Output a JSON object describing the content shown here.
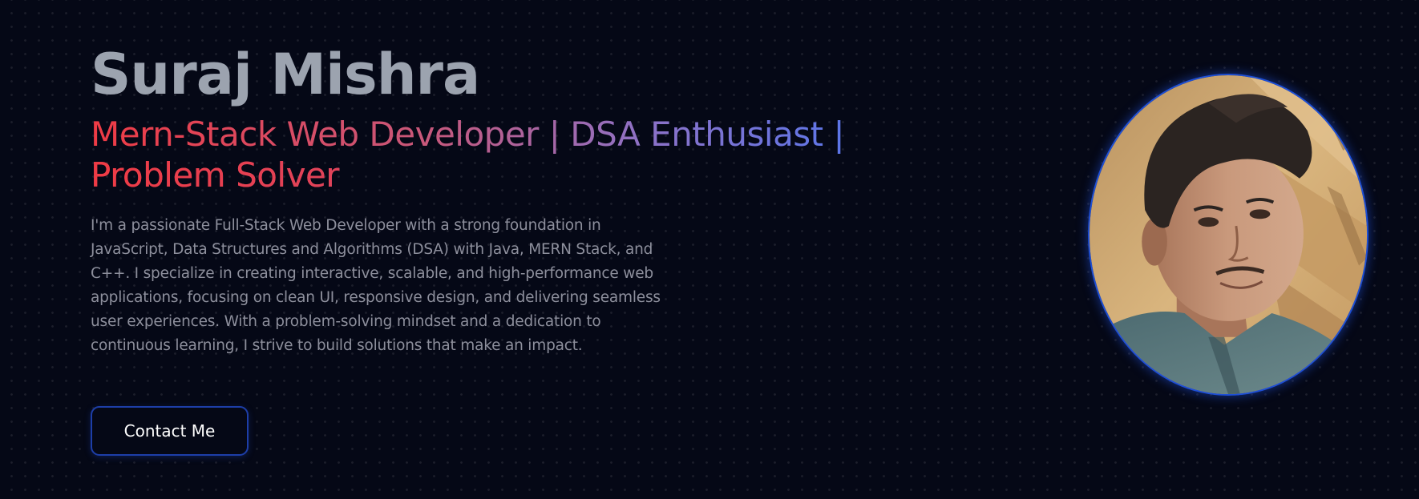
{
  "hero": {
    "name": "Suraj Mishra",
    "role_line1": "Mern-Stack Web Developer | DSA Enthusiast |",
    "role_line2": "Problem Solver",
    "bio": "I'm a passionate Full-Stack Web Developer with a strong foundation in JavaScript, Data Structures and Algorithms (DSA) with Java, MERN Stack, and C++. I specialize in creating interactive, scalable, and high-performance web applications, focusing on clean UI, responsive design, and delivering seamless user experiences. With a problem-solving mindset and a dedication to continuous learning, I strive to build solutions that make an impact.",
    "contact_button": "Contact Me"
  },
  "colors": {
    "background": "#050816",
    "name_text": "#9ca3af",
    "gradient_start": "#ef3b45",
    "gradient_end": "#5b76ea",
    "accent_border": "#1e4fd6"
  },
  "avatar": {
    "icon": "profile-photo"
  }
}
